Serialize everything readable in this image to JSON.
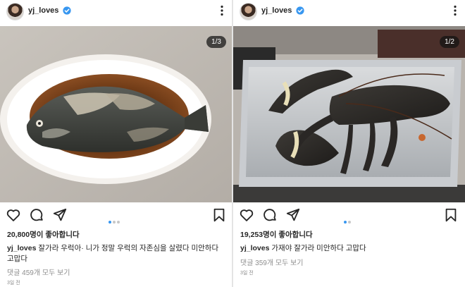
{
  "colors": {
    "verified": "#3897f0",
    "active_dot": "#3897f0",
    "muted_text": "#8e8e8e"
  },
  "posts": [
    {
      "username": "yj_loves",
      "counter": "1/3",
      "likes": "20,800명이 좋아합니다",
      "caption_user": "yj_loves",
      "caption_text": " 잘가라 우럭아·  니가 정말 우럭의 자존심을 살렸다 미안하다 고맙다",
      "comments": "댓글 459개 모두 보기",
      "time": "3일 전",
      "icons": [
        "heart-icon",
        "comment-icon",
        "share-icon",
        "bookmark-icon",
        "more-icon",
        "verified-icon"
      ]
    },
    {
      "username": "yj_loves",
      "counter": "1/2",
      "likes": "19,253명이 좋아합니다",
      "caption_user": "yj_loves",
      "caption_text": " 가재야 잘가라 미안하다 고맙다",
      "comments": "댓글 359개 모두 보기",
      "time": "3일 전",
      "icons": [
        "heart-icon",
        "comment-icon",
        "share-icon",
        "bookmark-icon",
        "more-icon",
        "verified-icon"
      ]
    }
  ]
}
